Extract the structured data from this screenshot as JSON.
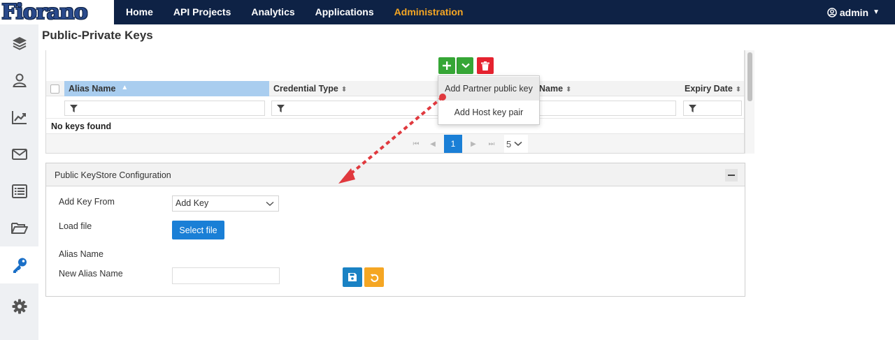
{
  "brand": {
    "logo_text": "Fiorano"
  },
  "nav": {
    "items": [
      "Home",
      "API Projects",
      "Analytics",
      "Applications",
      "Administration"
    ],
    "active": "Administration"
  },
  "user": {
    "name": "admin"
  },
  "sidebar": {
    "icons": [
      "layers-icon",
      "user-icon",
      "chart-line-icon",
      "envelope-icon",
      "list-icon",
      "folder-open-icon",
      "key-icon",
      "gear-icon"
    ],
    "active": "key-icon"
  },
  "page": {
    "title": "Public-Private Keys"
  },
  "grid": {
    "columns": [
      "Alias Name",
      "Credential Type",
      "Name",
      "Expiry Date"
    ],
    "sorted_column": "Alias Name",
    "empty_text": "No keys found",
    "pager": {
      "current_page": "1",
      "page_size": "5"
    }
  },
  "add_menu": {
    "items": [
      "Add Partner public key",
      "Add Host key pair"
    ],
    "hovered": "Add Partner public key"
  },
  "config": {
    "title": "Public KeyStore Configuration",
    "add_key_from_label": "Add Key From",
    "add_key_from_value": "Add Key",
    "load_file_label": "Load file",
    "select_file_label": "Select file",
    "alias_name_label": "Alias Name",
    "new_alias_name_label": "New Alias Name",
    "new_alias_name_value": ""
  },
  "colors": {
    "topbar": "#0e2245",
    "nav_active": "#f5a623",
    "primary": "#1a7fd6",
    "add_green": "#36a636",
    "delete_red": "#e5222f",
    "annotation_red": "#e0393e"
  }
}
